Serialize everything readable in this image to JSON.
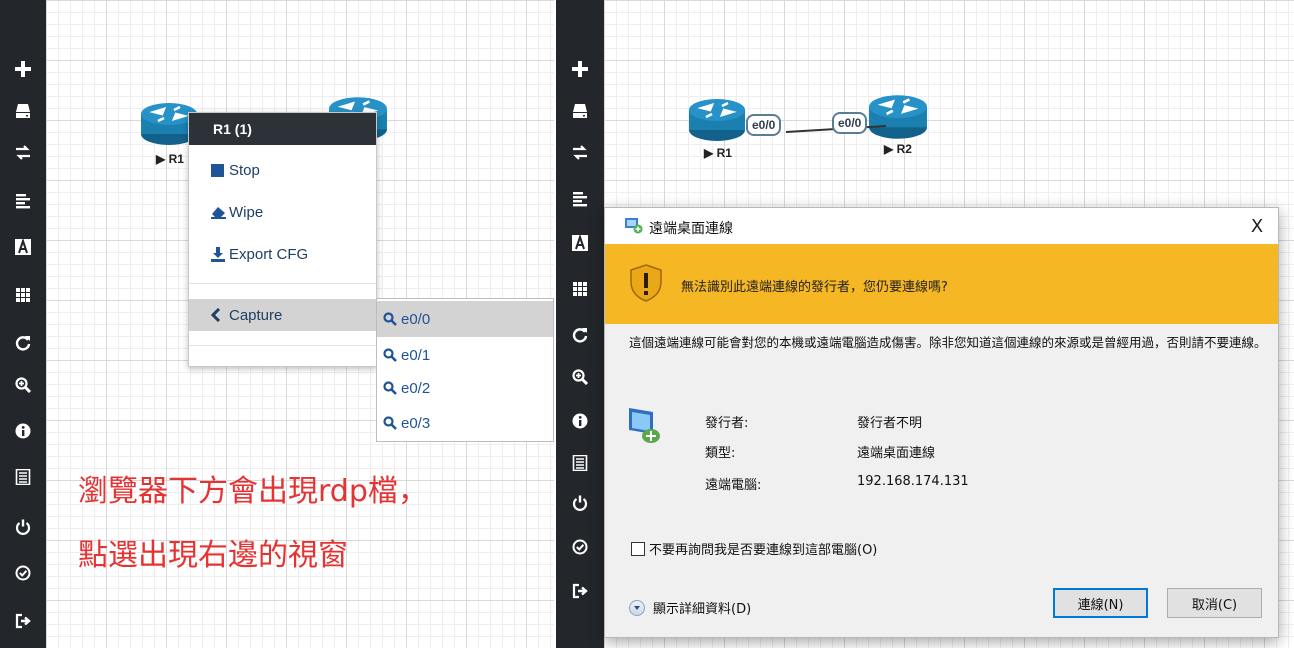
{
  "left": {
    "nodes": [
      {
        "label": "R1"
      },
      {
        "label": ""
      }
    ],
    "context_menu": {
      "header": "R1 (1)",
      "items": [
        {
          "label": "Stop",
          "icon": "stop-icon"
        },
        {
          "label": "Wipe",
          "icon": "eraser-icon"
        },
        {
          "label": "Export CFG",
          "icon": "download-icon"
        },
        {
          "label": "Capture",
          "icon": "chevron-left-icon"
        }
      ]
    },
    "capture_submenu": [
      {
        "label": "e0/0",
        "active": true
      },
      {
        "label": "e0/1",
        "active": false
      },
      {
        "label": "e0/2",
        "active": false
      },
      {
        "label": "e0/3",
        "active": false
      }
    ],
    "annotation": [
      "瀏覽器下方會出現rdp檔，",
      "點選出現右邊的視窗"
    ]
  },
  "right": {
    "nodes": [
      {
        "label": "R1",
        "port": "e0/0"
      },
      {
        "label": "R2",
        "port": "e0/0"
      }
    ]
  },
  "sidebar_icons": [
    "add-node-icon",
    "hdd-icon",
    "exchange-icon",
    "align-left-icon",
    "text-icon",
    "grid-icon",
    "refresh-icon",
    "zoom-in-icon",
    "info-icon",
    "list-icon",
    "power-icon",
    "check-circle-icon",
    "logout-icon"
  ],
  "dialog": {
    "title": "遠端桌面連線",
    "close": "X",
    "warning": "無法識別此遠端連線的發行者，您仍要連線嗎?",
    "body": "這個遠端連線可能會對您的本機或遠端電腦造成傷害。除非您知道這個連線的來源或是曾經用過，否則請不要連線。",
    "fields": [
      {
        "label": "發行者:",
        "value": "發行者不明"
      },
      {
        "label": "類型:",
        "value": "遠端桌面連線"
      },
      {
        "label": "遠端電腦:",
        "value": "192.168.174.131"
      }
    ],
    "checkbox_label": "不要再詢問我是否要連線到這部電腦(O)",
    "details_label": "顯示詳細資料(D)",
    "connect_button": "連線(N)",
    "cancel_button": "取消(C)"
  },
  "colors": {
    "sidebar": "#23272b",
    "router": "#1b7fb0",
    "warning_bar": "#f6b724",
    "annotation": "#e53333",
    "menu_header": "#2d3238"
  }
}
